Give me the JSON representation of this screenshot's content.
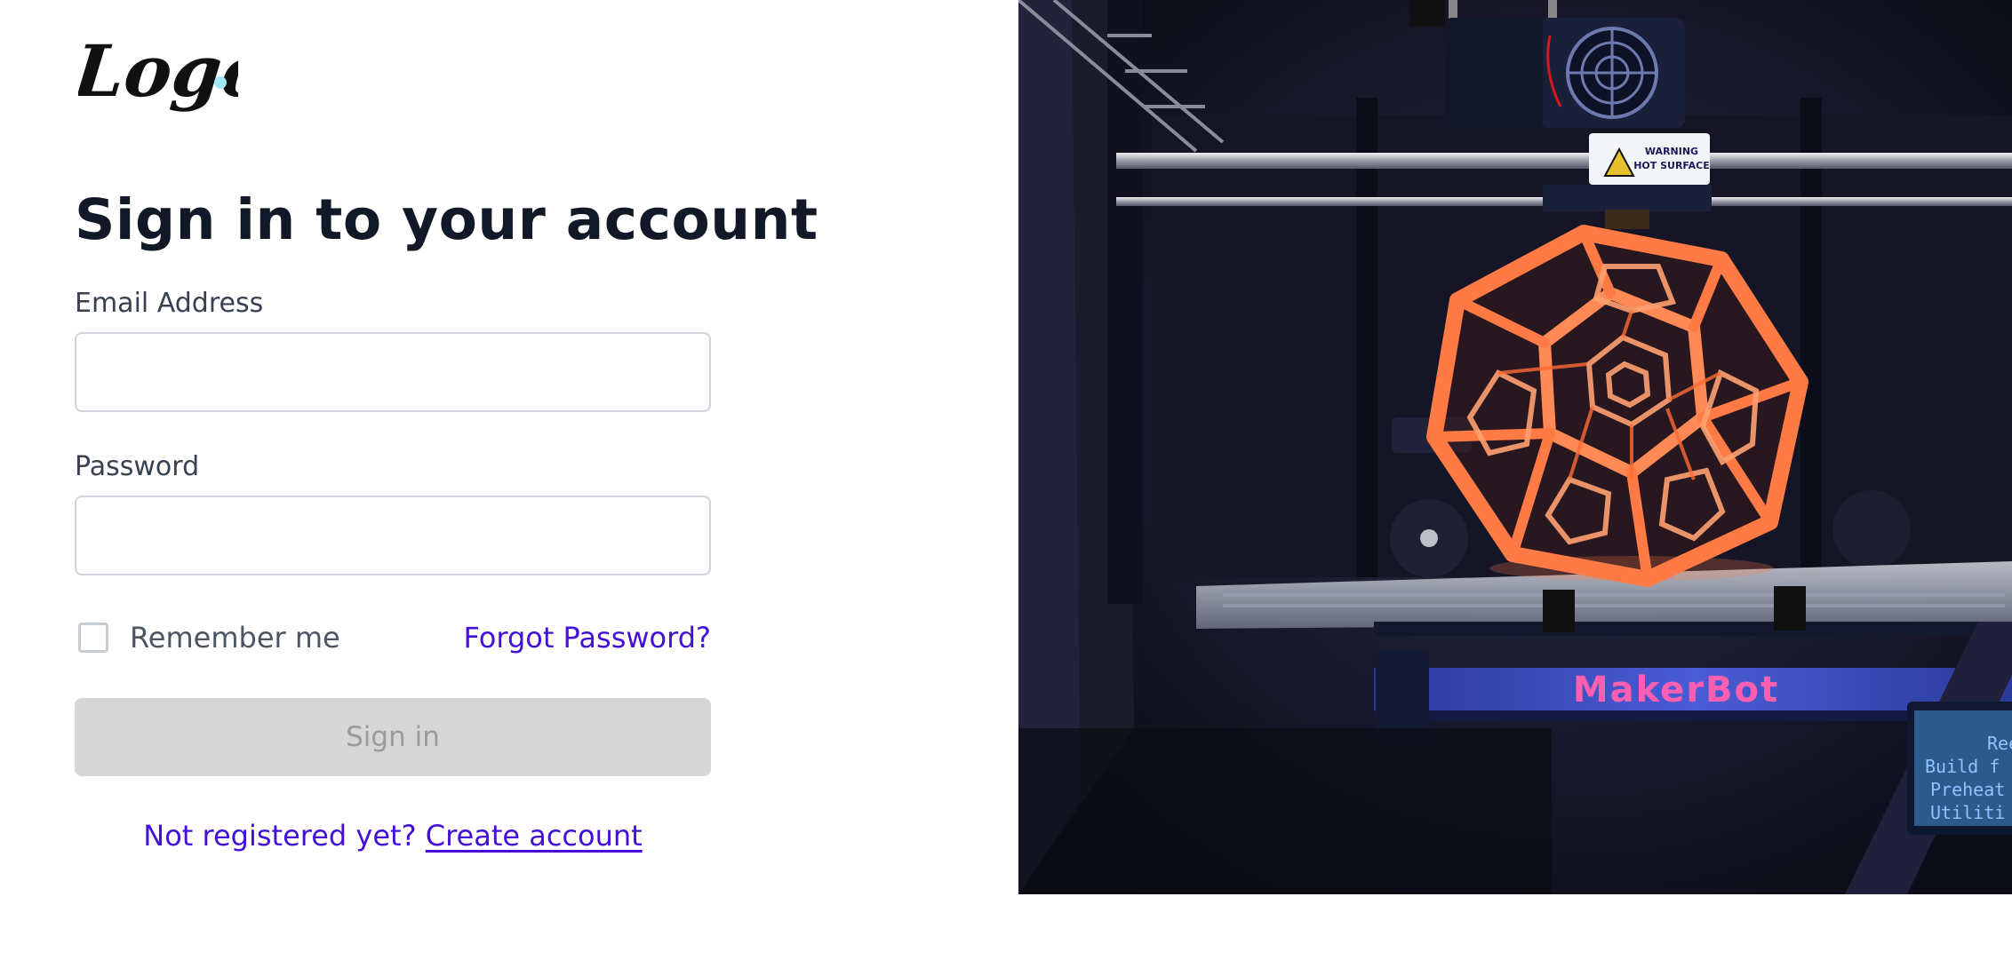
{
  "logo": {
    "text": "Logo",
    "dot_color": "#9ee8f0"
  },
  "form": {
    "title": "Sign in to your account",
    "email": {
      "label": "Email Address",
      "value": "",
      "placeholder": ""
    },
    "password": {
      "label": "Password",
      "value": "",
      "placeholder": ""
    },
    "remember": {
      "label": "Remember me",
      "checked": false
    },
    "forgot_label": "Forgot Password?",
    "signin_label": "Sign in",
    "register_prompt": "Not registered yet?",
    "register_link": "Create account"
  },
  "photo": {
    "subject": "3D printer printing an orange dodecahedron lattice",
    "warning_label": [
      "WARNING",
      "HOT SURFACE"
    ],
    "brand": "MakerBot",
    "screen_lines": [
      "Reel",
      "Build f",
      "Preheat",
      "Utiliti"
    ]
  },
  "colors": {
    "accent": "#4410d8",
    "title": "#111827",
    "button_disabled_bg": "#d6d6d6",
    "button_disabled_text": "#9b9b9b",
    "print_orange": "#ff7a45"
  }
}
